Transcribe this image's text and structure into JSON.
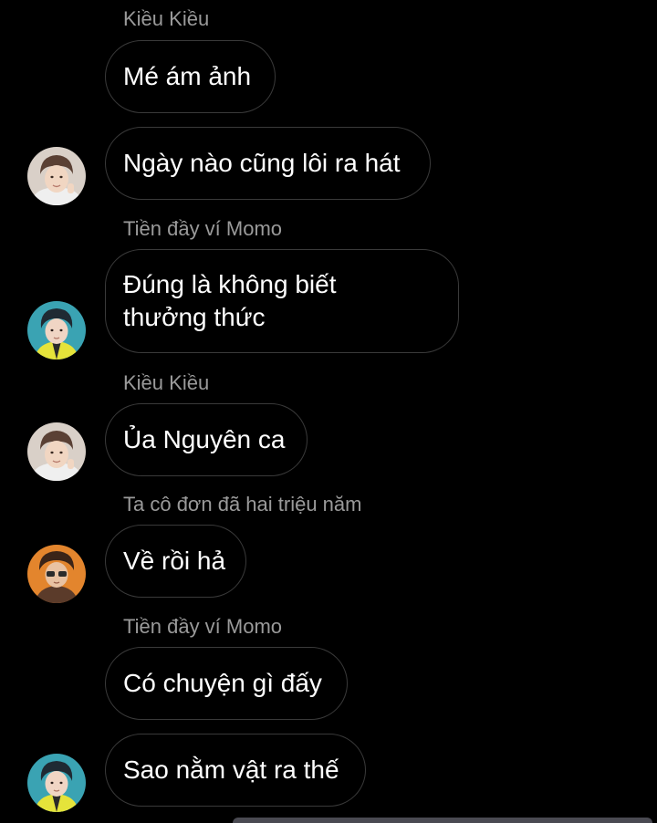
{
  "conversation": {
    "messages": [
      {
        "sender": "Kiều Kiều",
        "text": "Mé ám ảnh"
      },
      {
        "sender": "",
        "text": "Ngày nào cũng lôi ra hát",
        "avatar": "avatar-kieu-kieu"
      },
      {
        "sender": "Tiền đầy ví Momo",
        "text_line1": "Đúng là không biết",
        "text_line2": "thưởng thức",
        "avatar": "avatar-tien-day-vi-momo"
      },
      {
        "sender": "Kiều Kiều",
        "text": "Ủa Nguyên ca",
        "avatar": "avatar-kieu-kieu"
      },
      {
        "sender": "Ta cô đơn đã hai triệu năm",
        "text": "Về rồi hả",
        "avatar": "avatar-ta-co-don"
      },
      {
        "sender": "Tiền đầy ví Momo",
        "text": "Có chuyện gì đấy"
      },
      {
        "sender": "",
        "text": "Sao nằm vật ra thế",
        "avatar": "avatar-tien-day-vi-momo"
      }
    ]
  },
  "colors": {
    "background": "#000000",
    "bubble_border": "#3a3a3a",
    "sender_name": "#9a9a9a",
    "message_text": "#ffffff"
  }
}
